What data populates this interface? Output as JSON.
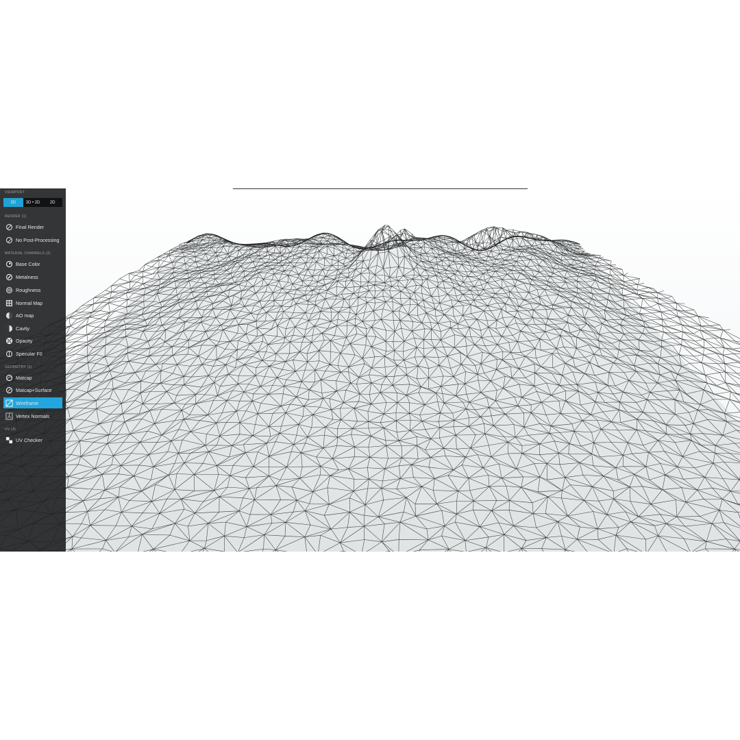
{
  "sidebar": {
    "viewport_title": "VIEWPORT",
    "modes": [
      {
        "label": "3D",
        "active": true
      },
      {
        "label": "3D • 2D",
        "active": false
      },
      {
        "label": "2D",
        "active": false
      }
    ],
    "sections": [
      {
        "title": "RENDER (1)",
        "items": [
          {
            "label": "Final Render",
            "icon": "final-render-icon"
          },
          {
            "label": "No Post-Processing",
            "icon": "no-post-processing-icon"
          }
        ]
      },
      {
        "title": "MATERIAL CHANNELS (2)",
        "items": [
          {
            "label": "Base Color",
            "icon": "base-color-icon"
          },
          {
            "label": "Metalness",
            "icon": "metalness-icon"
          },
          {
            "label": "Roughness",
            "icon": "roughness-icon"
          },
          {
            "label": "Normal Map",
            "icon": "normal-map-icon"
          },
          {
            "label": "AO map",
            "icon": "ao-map-icon"
          },
          {
            "label": "Cavity",
            "icon": "cavity-icon"
          },
          {
            "label": "Opacity",
            "icon": "opacity-icon"
          },
          {
            "label": "Specular F0",
            "icon": "specular-f0-icon"
          }
        ]
      },
      {
        "title": "GEOMETRY (3)",
        "items": [
          {
            "label": "Matcap",
            "icon": "matcap-icon"
          },
          {
            "label": "Matcap+Surface",
            "icon": "matcap-surface-icon"
          },
          {
            "label": "Wireframe",
            "icon": "wireframe-icon",
            "active": true
          },
          {
            "label": "Vertex Normals",
            "icon": "vertex-normals-icon"
          }
        ]
      },
      {
        "title": "UV (4)",
        "items": [
          {
            "label": "UV Checker",
            "icon": "uv-checker-icon"
          }
        ]
      }
    ]
  },
  "colors": {
    "accent": "#21a7dd",
    "sidebar_bg": "#1e1f21",
    "wire": "#1a1c1d",
    "surface": "#dfe3e4"
  }
}
